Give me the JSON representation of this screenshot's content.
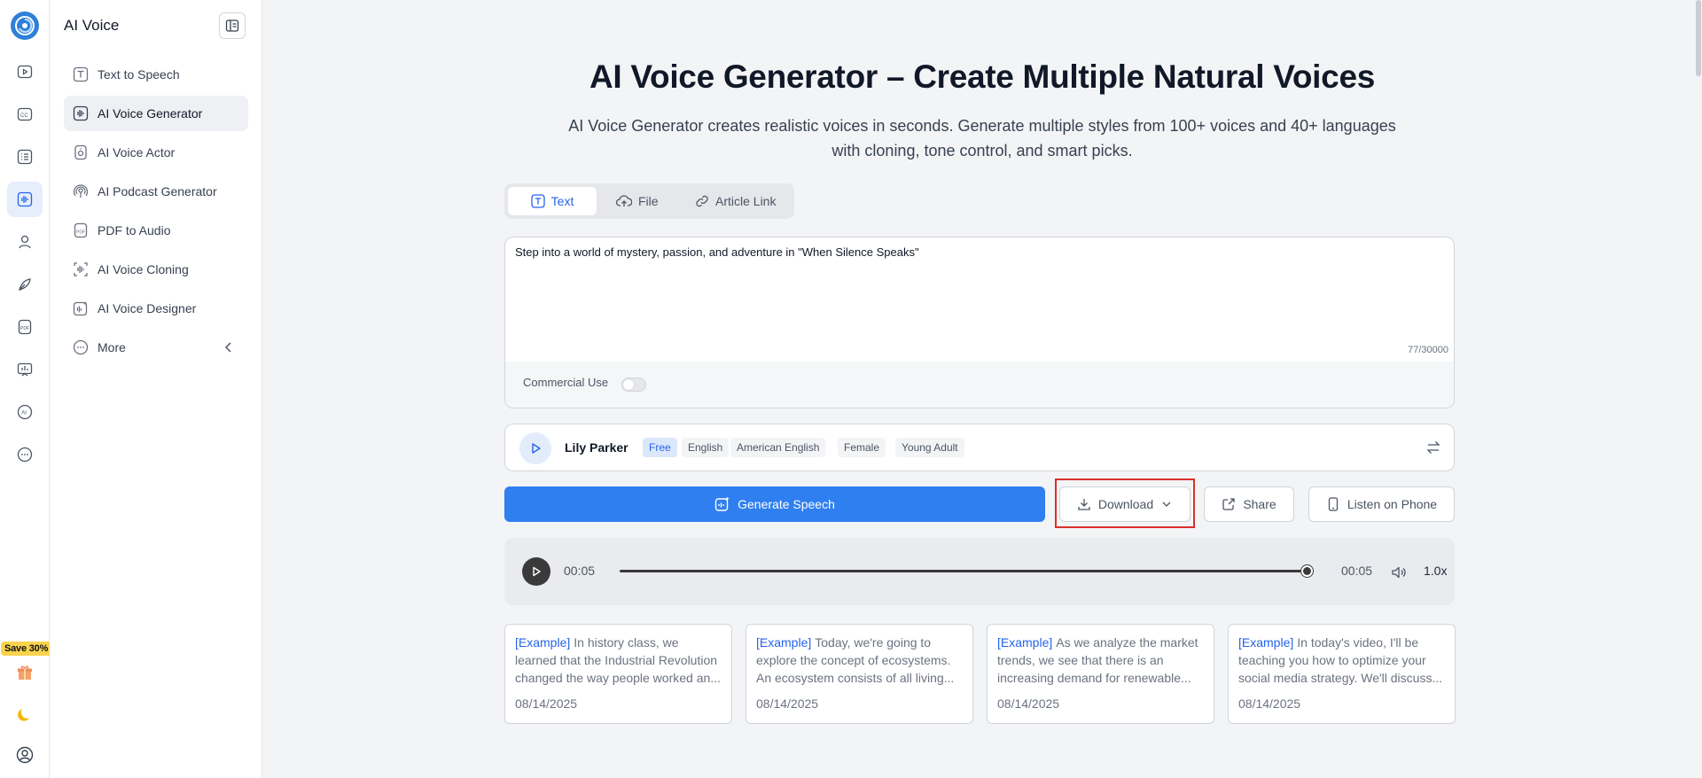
{
  "app": {
    "title": "AI Voice"
  },
  "rail": {
    "save_badge": "Save 30%"
  },
  "sidebar": {
    "items": [
      {
        "label": "Text to Speech"
      },
      {
        "label": "AI Voice Generator"
      },
      {
        "label": "AI Voice Actor"
      },
      {
        "label": "AI Podcast Generator"
      },
      {
        "label": "PDF to Audio"
      },
      {
        "label": "AI Voice Cloning"
      },
      {
        "label": "AI Voice Designer"
      },
      {
        "label": "More"
      }
    ]
  },
  "main": {
    "title": "AI Voice Generator – Create Multiple Natural Voices",
    "subtitle": "AI Voice Generator creates realistic voices in seconds. Generate multiple styles from 100+ voices and 40+ languages with cloning, tone control, and smart picks.",
    "tabs": [
      {
        "label": "Text"
      },
      {
        "label": "File"
      },
      {
        "label": "Article Link"
      }
    ],
    "editor": {
      "text": "Step into a world of mystery, passion, and adventure in \"When Silence Speaks\"",
      "count": "77/30000",
      "commercial_use_label": "Commercial Use",
      "commercial_use_on": false
    },
    "voice": {
      "name": "Lily Parker",
      "tags": [
        "Free",
        "English",
        "American English",
        "Female",
        "Young Adult"
      ]
    },
    "actions": {
      "generate": "Generate Speech",
      "download": "Download",
      "share": "Share",
      "listen": "Listen on Phone"
    },
    "player": {
      "current": "00:05",
      "total": "00:05",
      "speed": "1.0x",
      "progress": 1.0
    },
    "examples": [
      {
        "tag": "[Example]",
        "text": "In history class, we learned that the Industrial Revolution changed the way people worked an...",
        "date": "08/14/2025"
      },
      {
        "tag": "[Example]",
        "text": "Today, we're going to explore the concept of ecosystems. An ecosystem consists of all living...",
        "date": "08/14/2025"
      },
      {
        "tag": "[Example]",
        "text": "As we analyze the market trends, we see that there is an increasing demand for renewable...",
        "date": "08/14/2025"
      },
      {
        "tag": "[Example]",
        "text": "In today's video, I'll be teaching you how to optimize your social media strategy. We'll discuss...",
        "date": "08/14/2025"
      }
    ]
  },
  "colors": {
    "accent": "#2f7ff0",
    "highlight": "#d9302c",
    "badge": "#fbd34d"
  }
}
